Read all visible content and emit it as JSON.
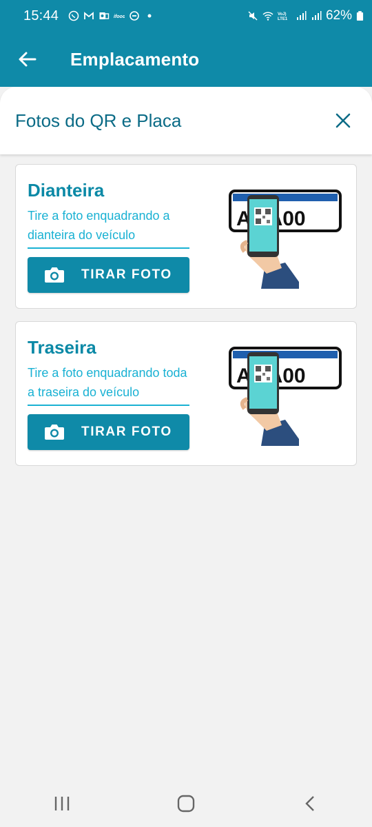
{
  "status_bar": {
    "time": "15:44",
    "battery": "62%",
    "icons_left": [
      "whatsapp-icon",
      "gmail-icon",
      "outlook-icon",
      "ifood-icon",
      "dnd-icon",
      "dot-icon"
    ],
    "icons_right": [
      "mute-icon",
      "wifi-icon",
      "volte-icon",
      "signal-icon",
      "signal-icon",
      "battery-icon"
    ]
  },
  "app_bar": {
    "title": "Emplacamento"
  },
  "sheet": {
    "title": "Fotos do QR e Placa"
  },
  "cards": [
    {
      "title": "Dianteira",
      "description": "Tire a foto enquadrando a dianteira do veículo",
      "button_label": "TIRAR FOTO",
      "plate_text": "A 1A00"
    },
    {
      "title": "Traseira",
      "description": "Tire a foto enquadrando toda a traseira do veículo",
      "button_label": "TIRAR FOTO",
      "plate_text": "A 1A00"
    }
  ],
  "colors": {
    "primary": "#0f8aa8",
    "title_text": "#0b89a6",
    "link_text": "#19b1d3",
    "header_text": "#0b6b86",
    "background": "#f2f2f2"
  }
}
